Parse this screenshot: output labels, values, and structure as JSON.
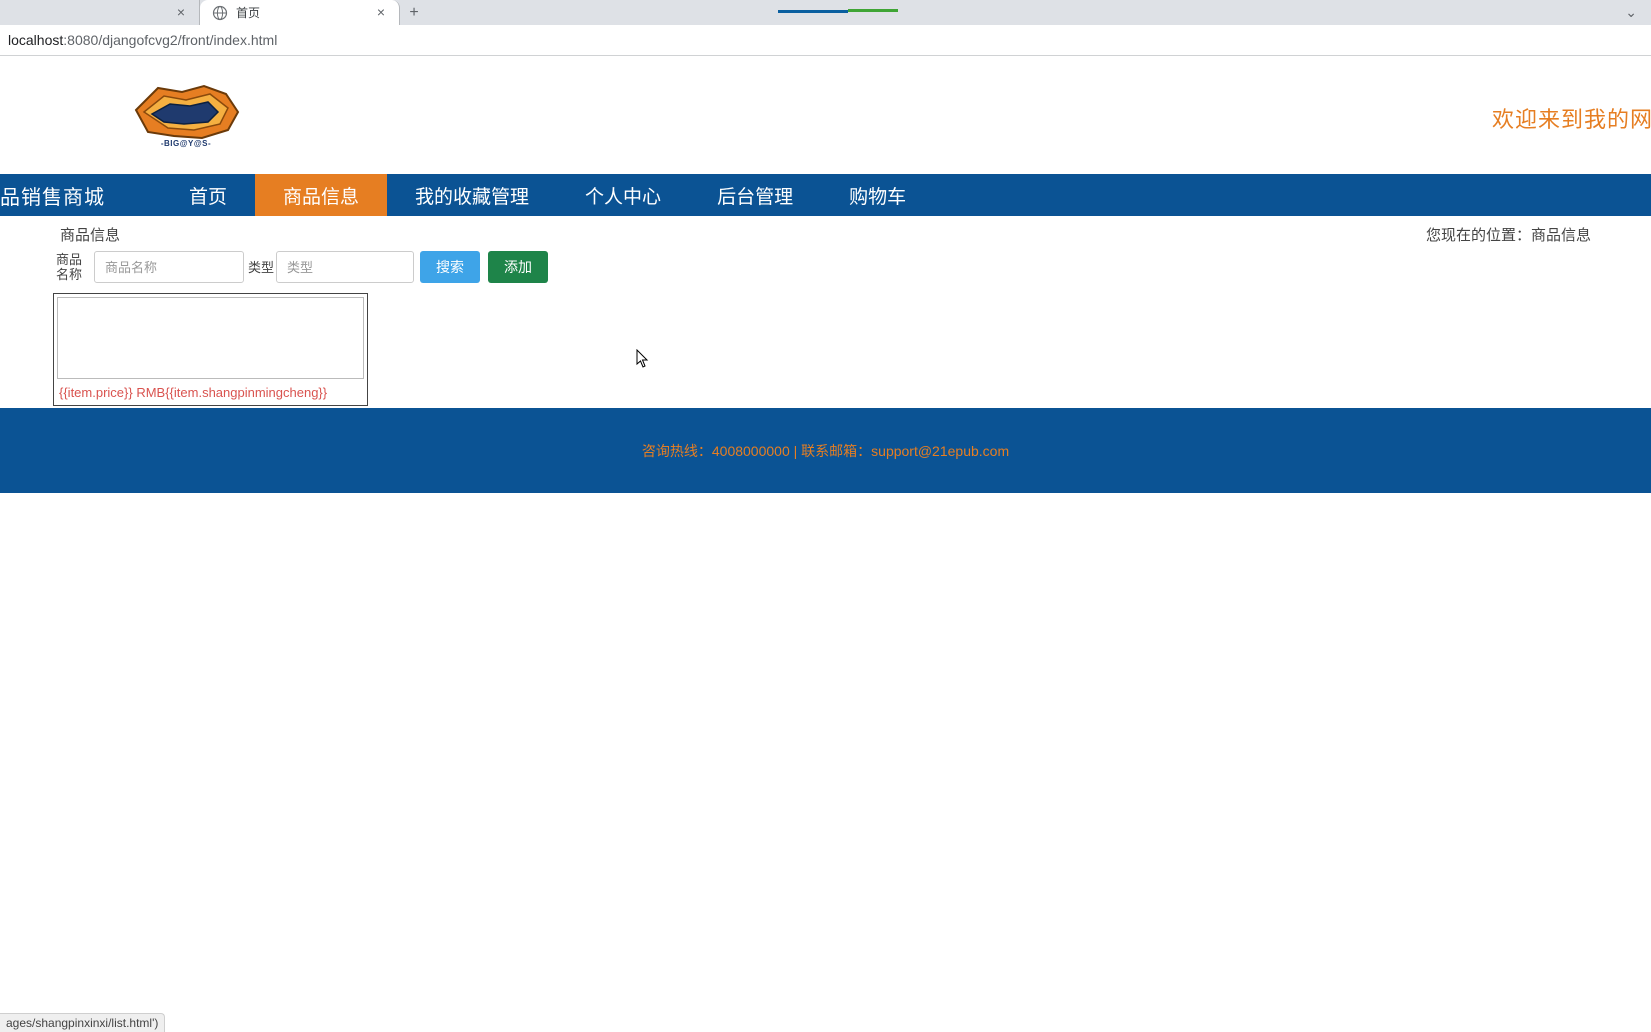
{
  "browser": {
    "tabs": [
      {
        "title": ""
      },
      {
        "title": "首页"
      }
    ],
    "address": {
      "host": "localhost",
      "port": ":8080",
      "path": "/djangofcvg2/front/index.html"
    },
    "status_text": "ages/shangpinxinxi/list.html')"
  },
  "header": {
    "welcome": "欢迎来到我的网",
    "logo_sub": "-BIG@Y@S-"
  },
  "nav": {
    "brand": "品销售商城",
    "items": [
      {
        "label": "首页"
      },
      {
        "label": "商品信息"
      },
      {
        "label": "我的收藏管理"
      },
      {
        "label": "个人中心"
      },
      {
        "label": "后台管理"
      },
      {
        "label": "购物车"
      }
    ]
  },
  "crumbs": {
    "left": "商品信息",
    "right": "您现在的位置：商品信息"
  },
  "filter": {
    "name_label": "商品名称",
    "name_placeholder": "商品名称",
    "type_label": "类型",
    "type_placeholder": "类型",
    "search_btn": "搜索",
    "add_btn": "添加"
  },
  "item": {
    "text": "{{item.price}} RMB{{item.shangpinmingcheng}}"
  },
  "footer": {
    "text": "咨询热线：4008000000 | 联系邮箱：support@21epub.com"
  }
}
